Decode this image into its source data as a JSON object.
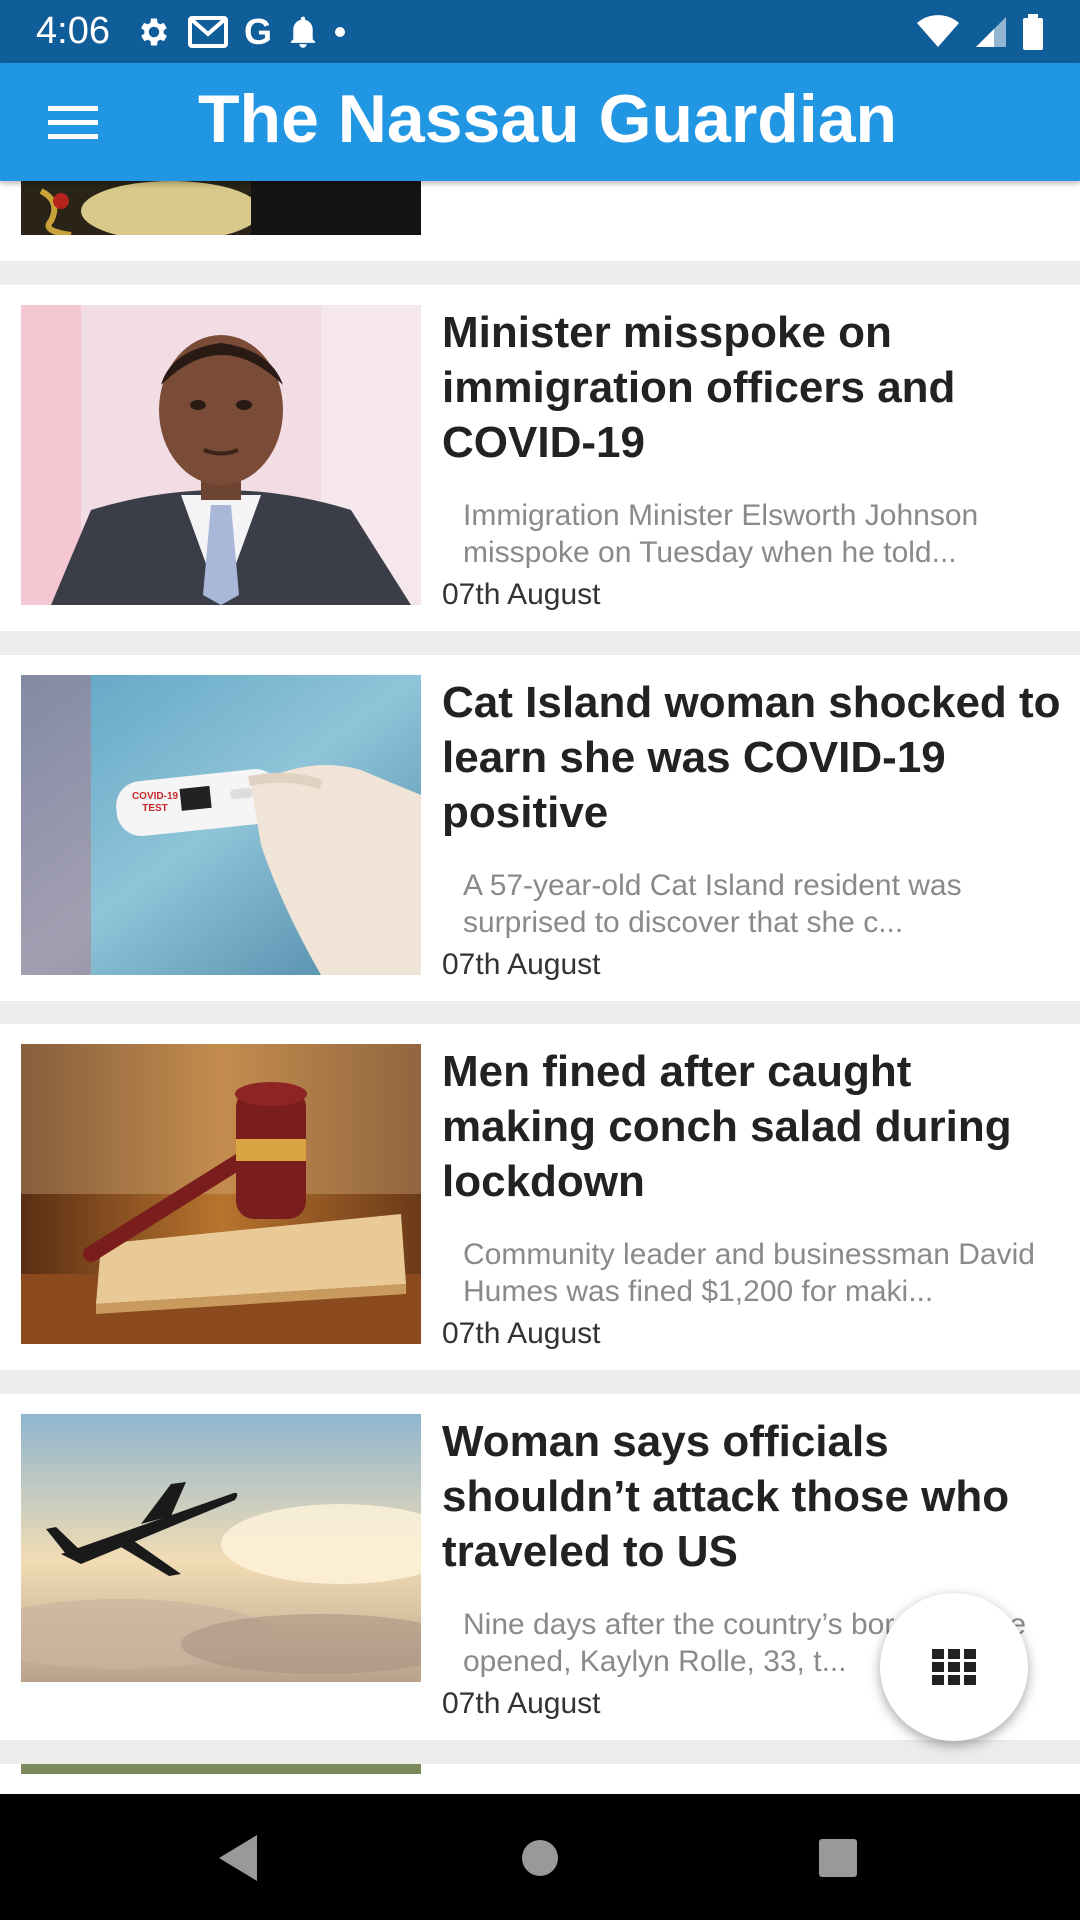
{
  "status_bar": {
    "time": "4:06",
    "left_icons": [
      "gear-icon",
      "gmail-icon",
      "google-icon",
      "bell-icon",
      "dot-icon"
    ],
    "right_icons": [
      "wifi-icon",
      "signal-icon",
      "battery-icon"
    ],
    "google_glyph": "G"
  },
  "app_bar": {
    "title": "The Nassau Guardian",
    "menu_icon": "hamburger-menu-icon",
    "color": "#2196e3"
  },
  "articles": [
    {
      "headline": "Minister misspoke on immigration officers and COVID-19",
      "excerpt": "Immigration Minister Elsworth Johnson misspoke on Tuesday when he told...",
      "date": "07th August",
      "image": "minister-portrait-image"
    },
    {
      "headline": "Cat Island woman shocked to learn she was COVID-19 positive",
      "excerpt": "A 57-year-old Cat Island resident was surprised to discover that she c...",
      "date": "07th August",
      "image": "covid-test-image",
      "image_text": "COVID-19 TEST"
    },
    {
      "headline": "Men fined after caught making conch salad during lockdown",
      "excerpt": "Community leader and businessman David Humes was fined $1,200 for maki...",
      "date": "07th August",
      "image": "gavel-image"
    },
    {
      "headline": "Woman says officials shouldn’t attack those who traveled to US",
      "excerpt": "Nine days after the country’s borders were opened, Kaylyn Rolle, 33, t...",
      "date": "07th August",
      "image": "airplane-image"
    }
  ],
  "fab": {
    "icon": "grid-icon"
  },
  "nav_bar": {
    "icons": [
      "back-icon",
      "home-icon",
      "recents-icon"
    ]
  }
}
